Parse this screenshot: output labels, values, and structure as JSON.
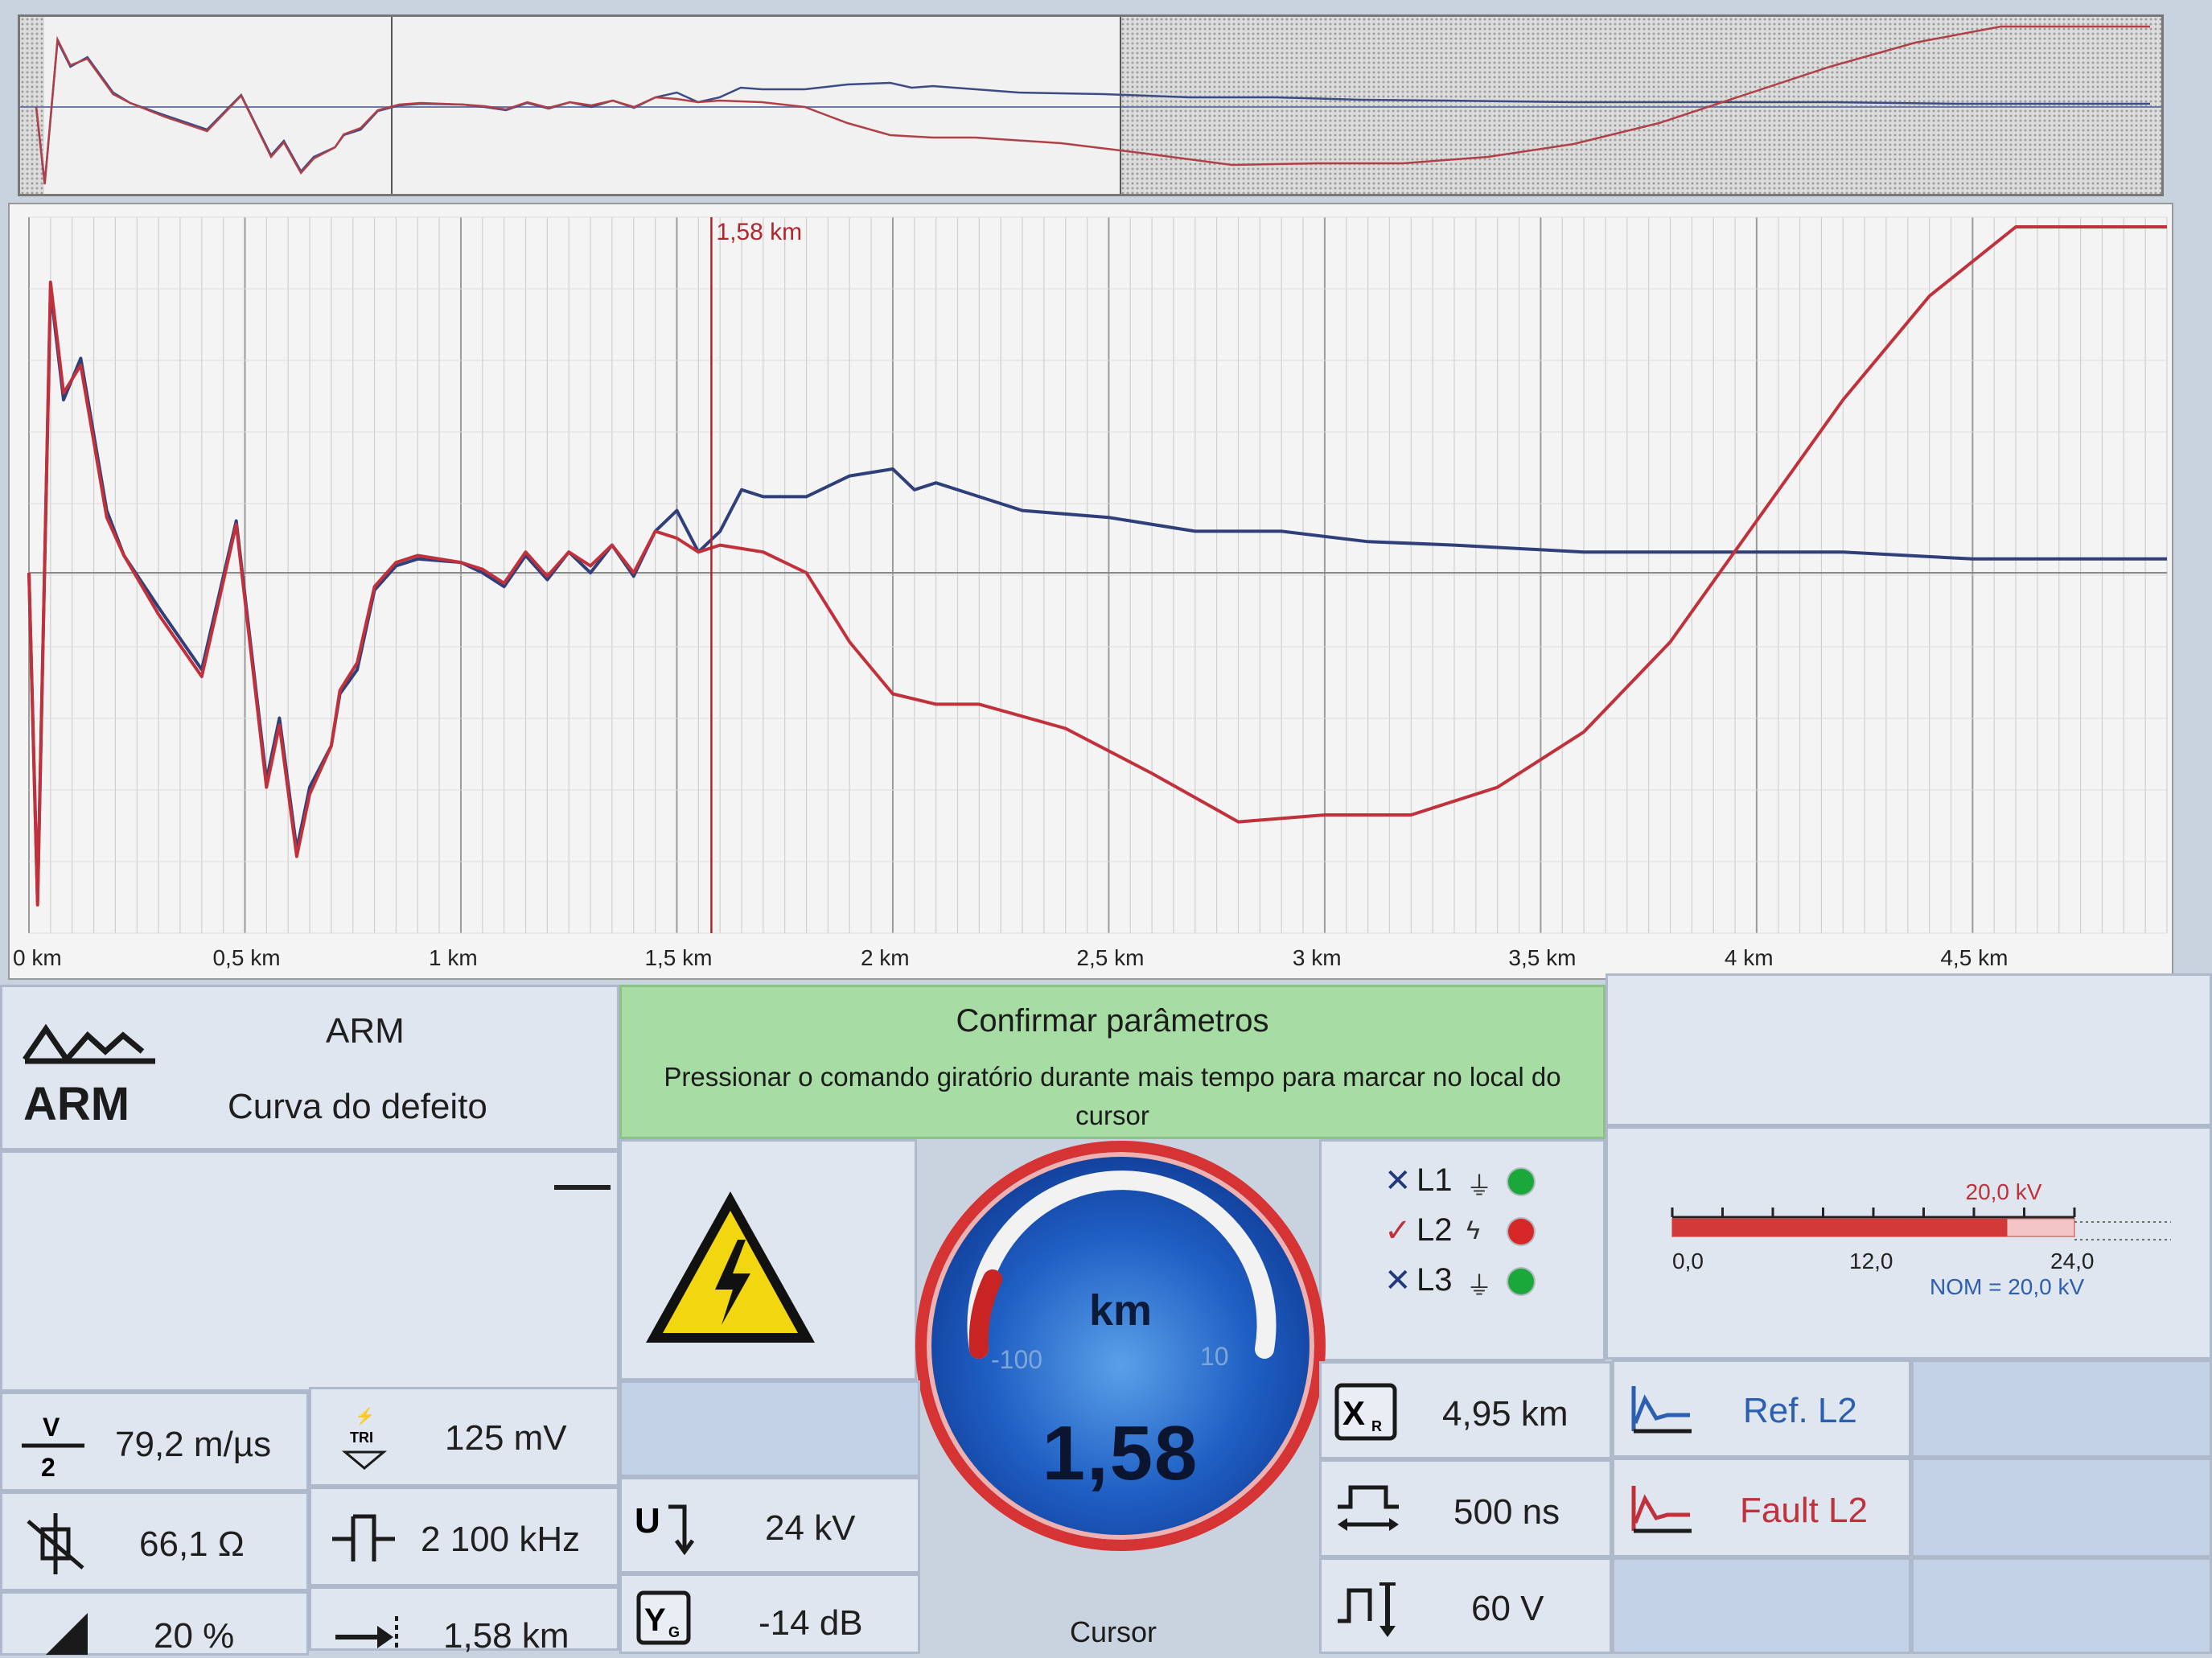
{
  "overview": {
    "cursor_label": ""
  },
  "main_chart": {
    "cursor_label": "1,58 km",
    "x_ticks": [
      "0 km",
      "0,5 km",
      "1 km",
      "1,5 km",
      "2 km",
      "2,5 km",
      "3 km",
      "3,5 km",
      "4 km",
      "4,5 km"
    ]
  },
  "chart_data": {
    "type": "line",
    "x_unit": "km",
    "xlim": [
      0,
      4.95
    ],
    "cursor_km": 1.58,
    "series": [
      {
        "color": "#2f3f7a",
        "x": [
          0,
          0.02,
          0.05,
          0.08,
          0.12,
          0.18,
          0.22,
          0.3,
          0.4,
          0.48,
          0.55,
          0.58,
          0.62,
          0.65,
          0.7,
          0.72,
          0.76,
          0.8,
          0.85,
          0.9,
          1.0,
          1.05,
          1.1,
          1.15,
          1.2,
          1.25,
          1.3,
          1.35,
          1.4,
          1.45,
          1.5,
          1.55,
          1.6,
          1.65,
          1.7,
          1.8,
          1.9,
          2.0,
          2.05,
          2.1,
          2.2,
          2.3,
          2.5,
          2.7,
          2.9,
          3.1,
          3.3,
          3.6,
          3.9,
          4.2,
          4.5,
          4.7,
          4.95
        ],
        "y": [
          0.0,
          -0.95,
          0.82,
          0.5,
          0.62,
          0.18,
          0.05,
          -0.1,
          -0.28,
          0.15,
          -0.6,
          -0.42,
          -0.8,
          -0.62,
          -0.5,
          -0.35,
          -0.28,
          -0.05,
          0.02,
          0.04,
          0.03,
          0.0,
          -0.04,
          0.05,
          -0.02,
          0.06,
          0.0,
          0.08,
          -0.01,
          0.12,
          0.18,
          0.06,
          0.12,
          0.24,
          0.22,
          0.22,
          0.28,
          0.3,
          0.24,
          0.26,
          0.22,
          0.18,
          0.16,
          0.12,
          0.12,
          0.09,
          0.08,
          0.06,
          0.06,
          0.06,
          0.04,
          0.04,
          0.04
        ]
      },
      {
        "color": "#c0313b",
        "x": [
          0,
          0.02,
          0.05,
          0.08,
          0.12,
          0.18,
          0.22,
          0.3,
          0.4,
          0.48,
          0.55,
          0.58,
          0.62,
          0.65,
          0.7,
          0.72,
          0.76,
          0.8,
          0.85,
          0.9,
          1.0,
          1.05,
          1.1,
          1.15,
          1.2,
          1.25,
          1.3,
          1.35,
          1.4,
          1.45,
          1.5,
          1.55,
          1.6,
          1.7,
          1.8,
          1.9,
          2.0,
          2.1,
          2.2,
          2.4,
          2.6,
          2.8,
          3.0,
          3.2,
          3.4,
          3.6,
          3.8,
          4.0,
          4.2,
          4.4,
          4.6,
          4.8,
          4.95
        ],
        "y": [
          0.0,
          -0.96,
          0.84,
          0.52,
          0.6,
          0.16,
          0.05,
          -0.12,
          -0.3,
          0.14,
          -0.62,
          -0.44,
          -0.82,
          -0.64,
          -0.5,
          -0.34,
          -0.26,
          -0.04,
          0.03,
          0.05,
          0.03,
          0.01,
          -0.03,
          0.06,
          -0.01,
          0.06,
          0.02,
          0.08,
          0.0,
          0.12,
          0.1,
          0.06,
          0.08,
          0.06,
          0.0,
          -0.2,
          -0.35,
          -0.38,
          -0.38,
          -0.45,
          -0.58,
          -0.72,
          -0.7,
          -0.7,
          -0.62,
          -0.46,
          -0.2,
          0.15,
          0.5,
          0.8,
          1.0,
          1.0,
          1.0
        ]
      }
    ]
  },
  "arm_panel": {
    "logo_text": "ARM",
    "mode": "ARM",
    "curve": "Curva do defeito"
  },
  "message": {
    "title": "Confirmar parâmetros",
    "body": "Pressionar o comando giratório durante mais tempo para marcar no local do cursor"
  },
  "phases": [
    {
      "mark": "✕",
      "label": "L1",
      "symbol": "⏚",
      "status_color": "#1aa83a"
    },
    {
      "mark": "✓",
      "label": "L2",
      "symbol": "ϟ",
      "status_color": "#d62828"
    },
    {
      "mark": "✕",
      "label": "L3",
      "symbol": "⏚",
      "status_color": "#1aa83a"
    }
  ],
  "voltage_bar": {
    "value_label": "20,0 kV",
    "min_label": "0,0",
    "mid_label": "12,0",
    "max_label": "24,0",
    "nominal_label": "NOM = 20,0 kV",
    "fill_fraction": 0.833
  },
  "gauge": {
    "unit": "km",
    "scale_left": "-100",
    "scale_right": "10",
    "value": "1,58",
    "caption": "Cursor"
  },
  "params": {
    "velocity": "79,2 m/µs",
    "trigger": "125 mV",
    "impedance": "66,1 Ω",
    "frequency": "2 100 kHz",
    "percent": "20 %",
    "distance": "1,58 km",
    "voltage": "24 kV",
    "gain": "-14 dB",
    "xr": "4,95 km",
    "pulse": "500 ns",
    "pulse_voltage": "60 V"
  },
  "refs": {
    "ref": "Ref. L2",
    "fault": "Fault L2"
  },
  "colors": {
    "fault_red": "#c0313b",
    "ref_blue": "#2f3f7a",
    "ok_green": "#1aa83a"
  }
}
